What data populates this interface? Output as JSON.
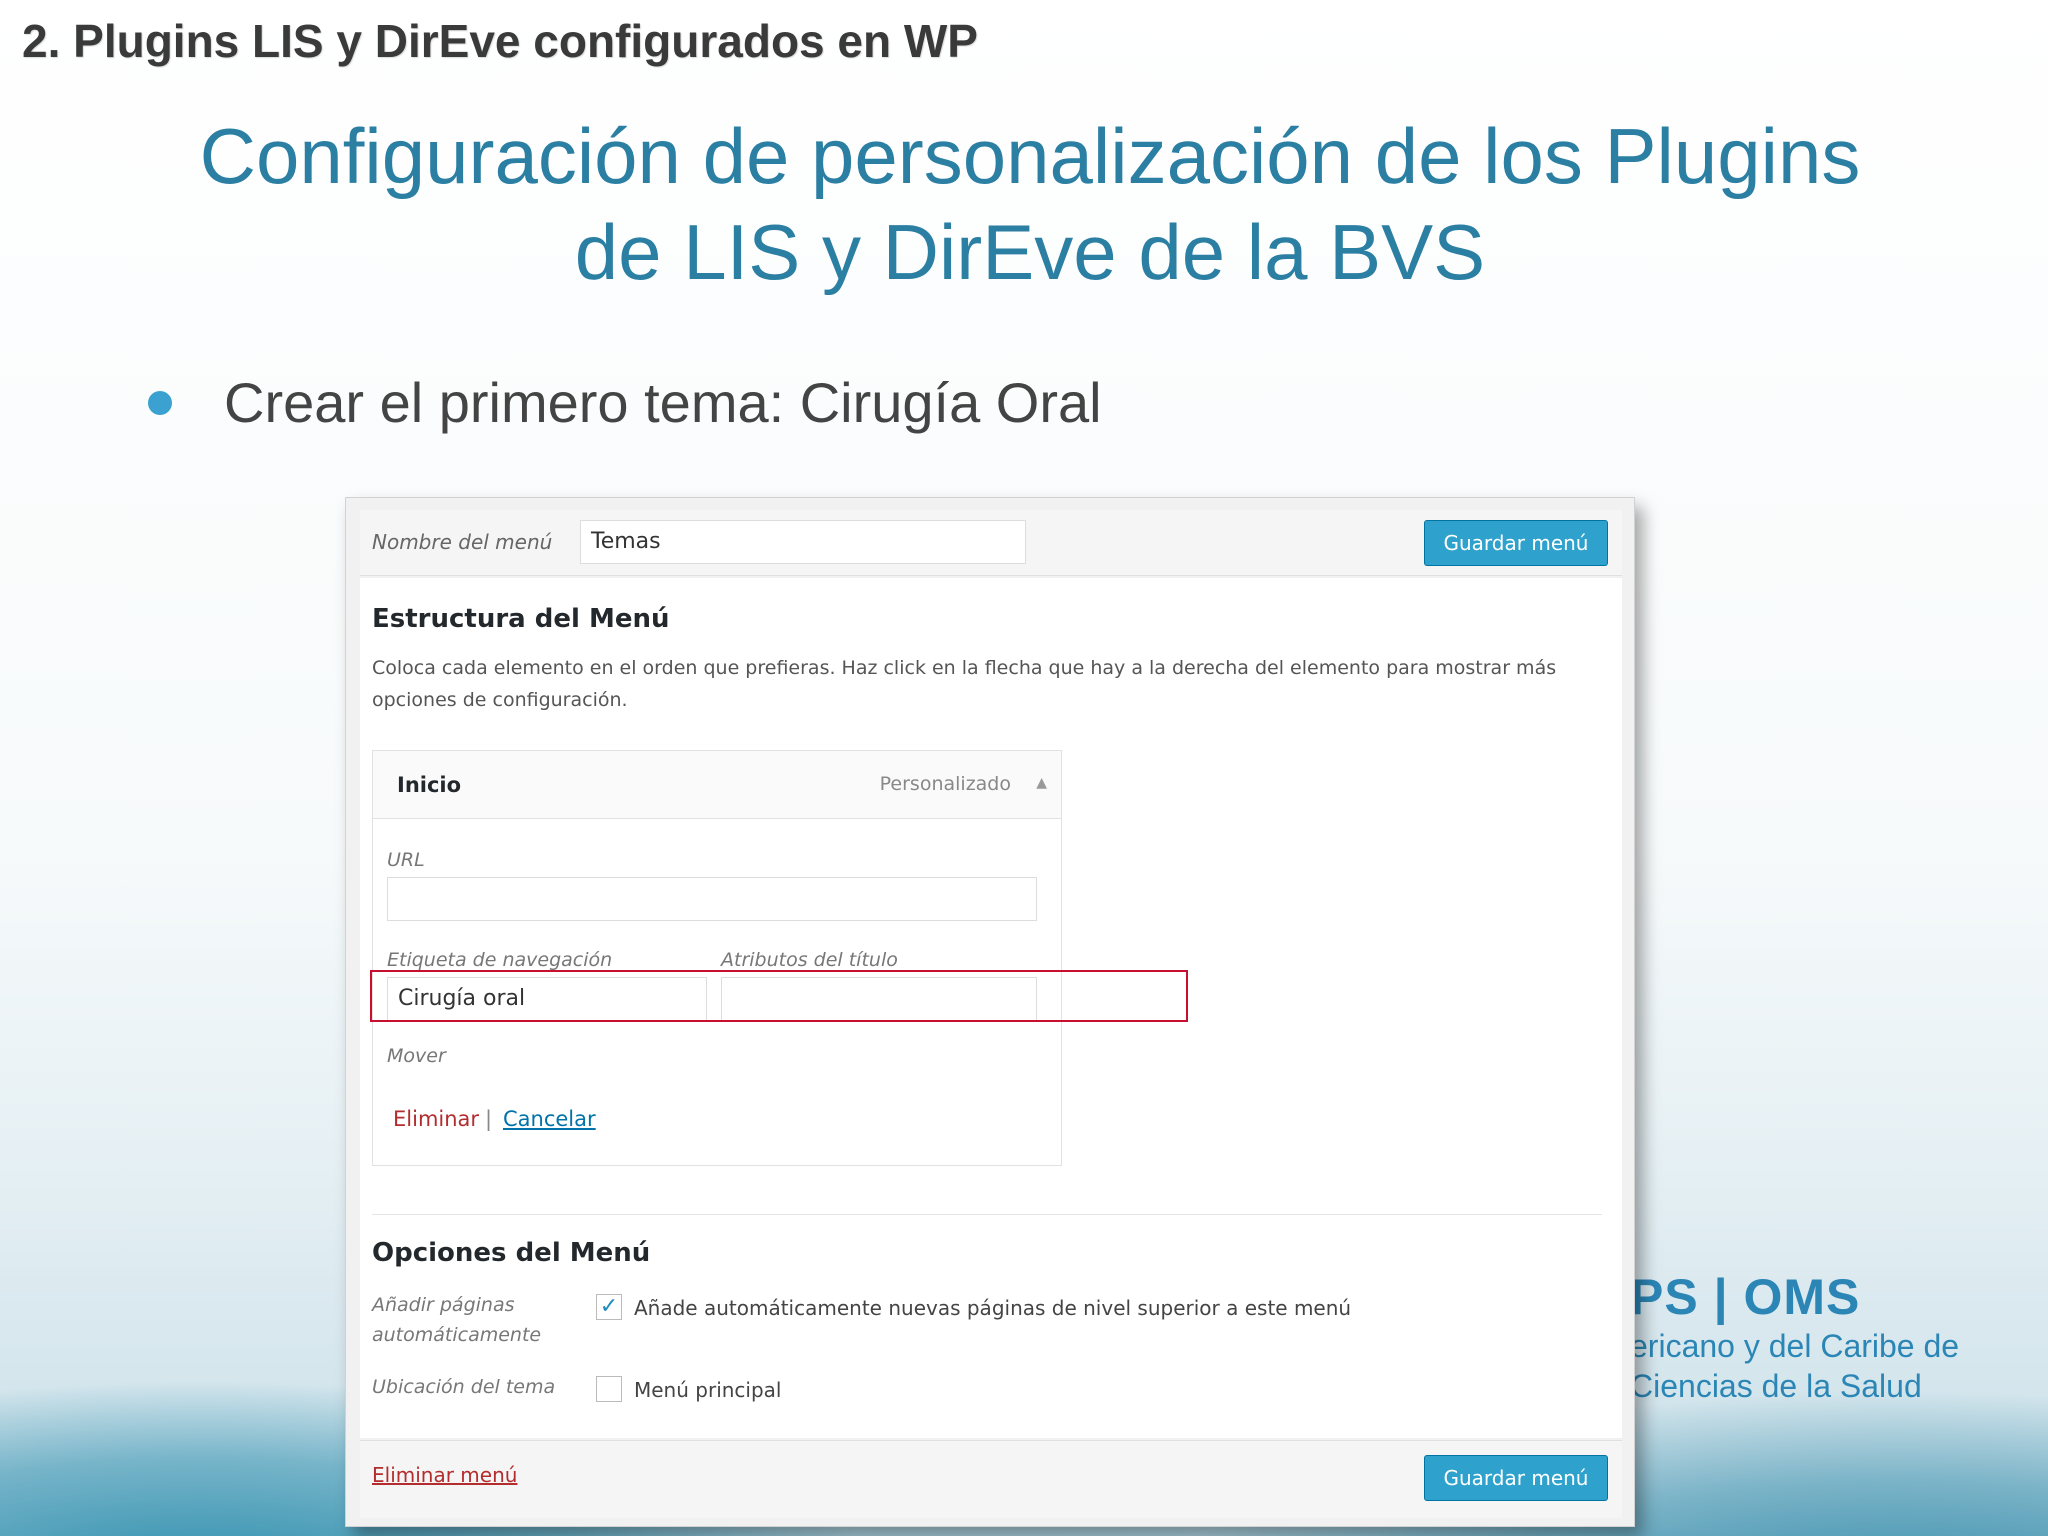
{
  "slide": {
    "section_title": "2. Plugins LIS y DirEve configurados en WP",
    "title_line1": "Configuración de personalización de los Plugins",
    "title_line2": "de LIS y DirEve de la BVS",
    "bullet": "Crear el primero tema: Cirugía Oral"
  },
  "logo": {
    "line1": "PS | OMS",
    "line2": "ericano y del Caribe de",
    "line3": "Ciencias de la Salud"
  },
  "wp": {
    "menu_name_label": "Nombre del menú",
    "menu_name_value": "Temas",
    "save_button": "Guardar menú",
    "structure_heading": "Estructura del Menú",
    "structure_desc": "Coloca cada elemento en el orden que prefieras. Haz click en la flecha que hay a la derecha del elemento para mostrar más opciones de configuración.",
    "item": {
      "title": "Inicio",
      "type": "Personalizado",
      "arrow": "▲",
      "url_label": "URL",
      "url_value": "",
      "nav_label_label": "Etiqueta de navegación",
      "nav_label_value": "Cirugía oral",
      "title_attr_label": "Atributos del título",
      "title_attr_value": "",
      "move_label": "Mover",
      "delete_link": "Eliminar",
      "separator": "|",
      "cancel_link": "Cancelar"
    },
    "options_heading": "Opciones del Menú",
    "auto_add_label": "Añadir páginas automáticamente",
    "auto_add_text": "Añade automáticamente nuevas páginas de nivel superior a este menú",
    "auto_add_checked": "✓",
    "location_label": "Ubicación del tema",
    "location_text": "Menú principal",
    "delete_menu_link": "Eliminar menú"
  },
  "colors": {
    "title_blue": "#2b7fa3",
    "wp_button": "#2ea2cc",
    "highlight_red": "#c8102e"
  }
}
